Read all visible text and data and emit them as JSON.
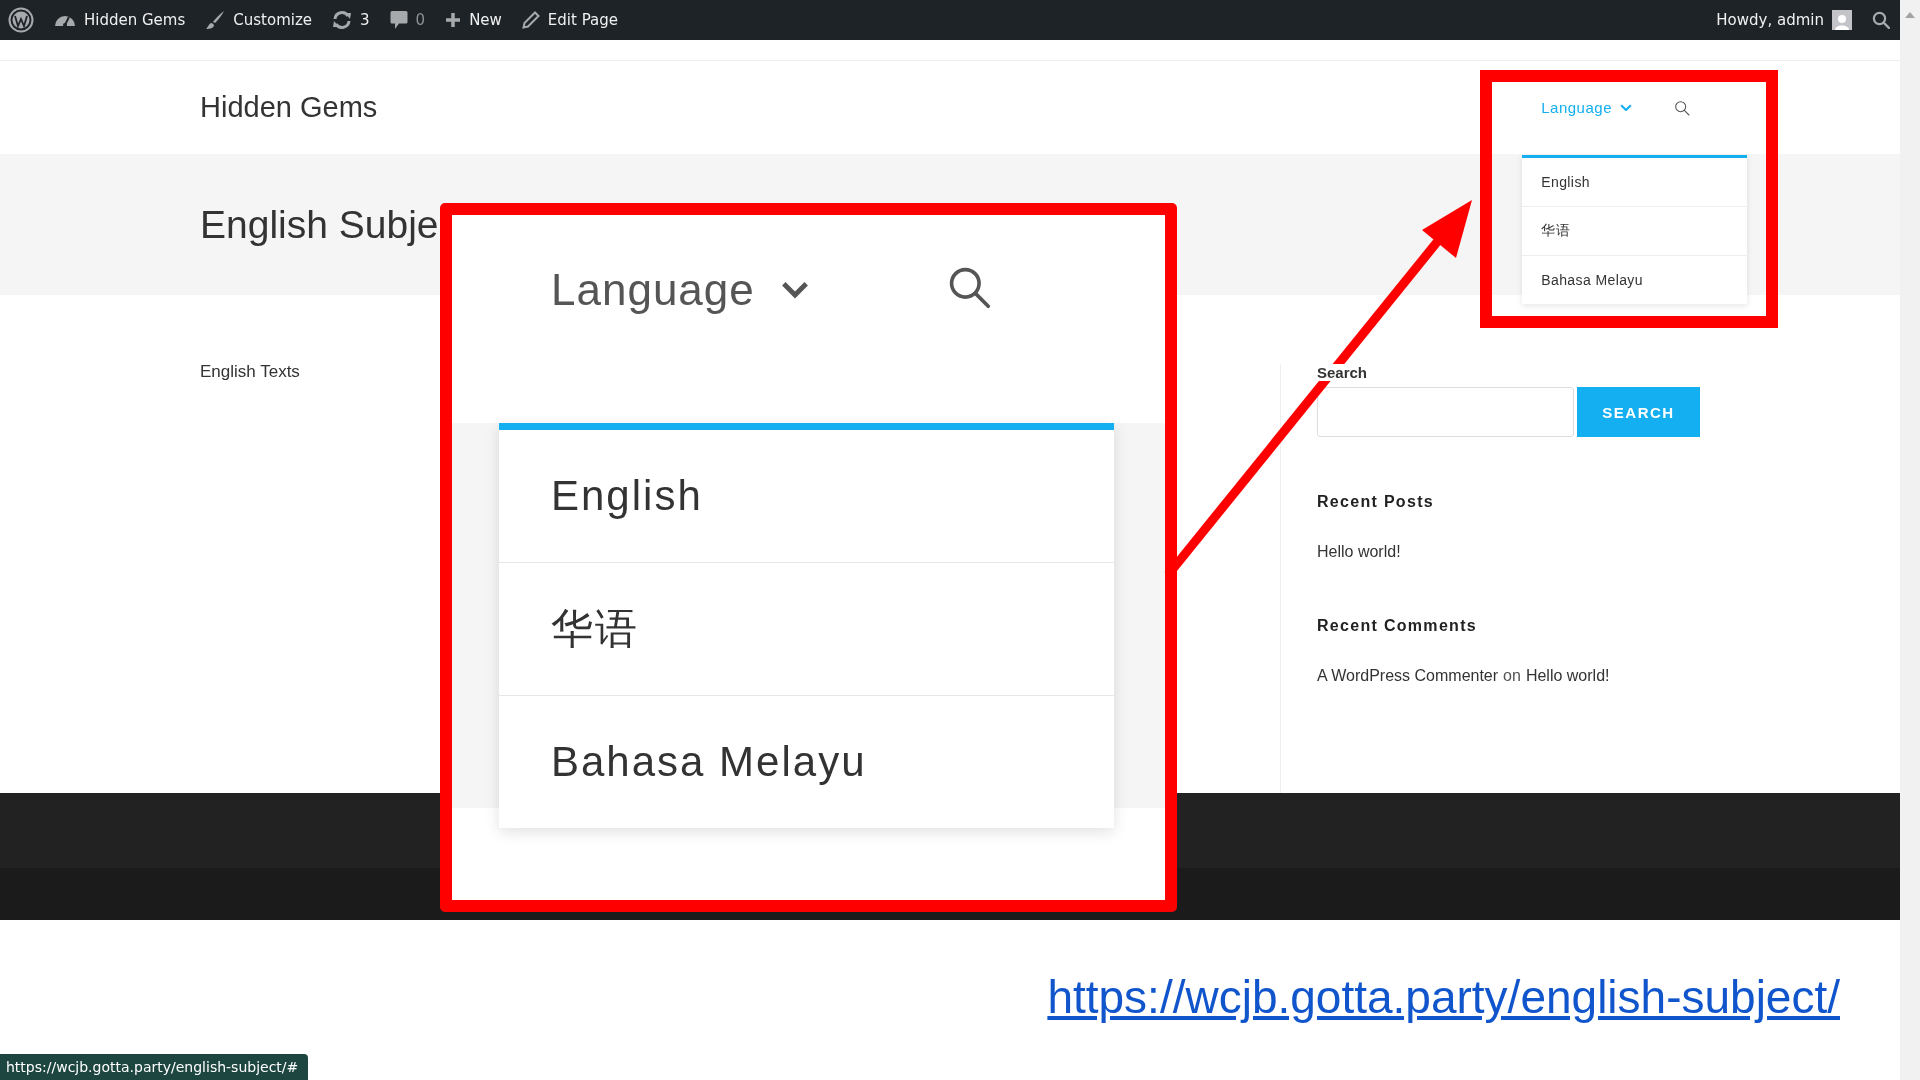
{
  "admin_bar": {
    "items": [
      {
        "kind": "logo"
      },
      {
        "kind": "site",
        "label": "Hidden Gems"
      },
      {
        "kind": "customize",
        "label": "Customize"
      },
      {
        "kind": "updates",
        "label": "3"
      },
      {
        "kind": "comments",
        "label": "0"
      },
      {
        "kind": "new",
        "label": "New"
      },
      {
        "kind": "edit",
        "label": "Edit Page"
      }
    ],
    "greeting": "Howdy, admin"
  },
  "header": {
    "site_title": "Hidden Gems",
    "menu_label": "Language",
    "dropdown": [
      {
        "label": "English"
      },
      {
        "label": "华语"
      },
      {
        "label": "Bahasa Melayu"
      }
    ]
  },
  "page_title": "English Subje",
  "content": {
    "text": "English Texts"
  },
  "sidebar": {
    "search_label": "Search",
    "search_button": "SEARCH",
    "recent_posts_title": "Recent Posts",
    "recent_posts": [
      "Hello world!"
    ],
    "recent_comments_title": "Recent Comments",
    "recent_comments": [
      {
        "author": "A WordPress Commenter",
        "joiner": "on",
        "post": "Hello world!"
      }
    ]
  },
  "zoom_inset": {
    "menu_label": "Language",
    "dropdown": [
      {
        "label": "English"
      },
      {
        "label": "华语"
      },
      {
        "label": "Bahasa Melayu"
      }
    ]
  },
  "annotation_link": "https://wcjb.gotta.party/english-subject/",
  "status_url": "https://wcjb.gotta.party/english-subject/#"
}
